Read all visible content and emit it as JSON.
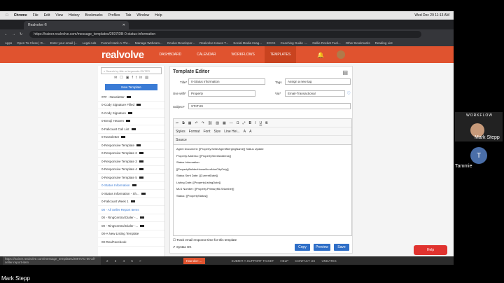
{
  "mac_menu": {
    "apple": "",
    "items": [
      "Chrome",
      "File",
      "Edit",
      "View",
      "History",
      "Bookmarks",
      "Profiles",
      "Tab",
      "Window",
      "Help"
    ],
    "clock": "Wed Dec 29 11:13 AM"
  },
  "browser": {
    "tab_title": "Realvolve ®",
    "url": "https://trainer.realvolve.com/message_templates/2697IDB-0-status-information",
    "bookmarks": [
      "Apps",
      "Open To Close | R...",
      "Enter your email |...",
      "Legal Ads",
      "Funnel Hack-A-Thr...",
      "Manage Webcam...",
      "Oculus Developer...",
      "Realvolve Issues T...",
      "Social Media Imag...",
      "ECCK",
      "Coaching Guide -...",
      "Nellie Rocket Fuel...",
      "Other Bookmarks",
      "Reading List"
    ]
  },
  "app": {
    "logo": "realvolve",
    "nav": [
      "DASHBOARD",
      "CALENDAR",
      "WORKFLOWS",
      "TEMPLATES"
    ],
    "active_nav": "TEMPLATES"
  },
  "sidebar": {
    "search_placeholder": "Search by title or keywords ENTER",
    "new_button": "New Template",
    "items": [
      "### - Newsletter",
      "0-Cody Signature Filled",
      "0-Cody Signature",
      "0-Emoji Heaven",
      "0-Fallcount Call List",
      "0-Newsletter",
      "0-Responsive Template",
      "0-Responsive Template 2",
      "0-Responsive Template 3",
      "0-Responsive Template 4",
      "0-Responsive Template 5",
      "0-Status Information",
      "0-Status Information - Sh...",
      "0-Fallcount Week 1",
      "00 - All Seller Report Items",
      "00 - RingCentral Dialer -...",
      "00 - RingCentral Dialer -...",
      "00-A New Listing Template",
      "00-RealFacebook"
    ],
    "active": "0-Status Information"
  },
  "editor": {
    "heading": "Template Editor",
    "title_label": "Title*",
    "title_value": "0-Status Information",
    "tags_label": "Tags",
    "tags_value": "Assign a new tag",
    "use_with_label": "Use with*",
    "use_with_value": "Property",
    "via_label": "Via*",
    "via_value": "Email-Transactional",
    "subject_label": "Subject*",
    "subject_value": "STATUS",
    "toolbar_row2": [
      "Styles",
      "Format",
      "Font",
      "Size",
      "Line Hei..."
    ],
    "source_label": "Source",
    "body_lines": [
      "Agent Document: [[Property.SellerAgentMergingName]] Status Update",
      "Property Address: [[PropertyStreetAddress]]",
      "Status Information:",
      "[[PropertyBuilderHouseNumNonCityOnly]]",
      "Status Sent Date: [[CurrentDate]]",
      "Listing Date: [[PropertyListingDate]]",
      "MLS Number: [[Property.PrimaryMLSNumber]]",
      "Status: [[PropertyStatus]]"
    ],
    "track_label": "Track email response time for this template",
    "syntax_label": "Syntax OK",
    "copy": "Copy",
    "preview": "Preview",
    "save": "Save"
  },
  "footer": {
    "status_url": "https://trainer.realvolve.com/message_templates/2897IAC-00-all-seller-report-item",
    "pager": [
      "2",
      "3",
      "4",
      "5",
      ">"
    ],
    "howdo": "How do I ...",
    "links": [
      "SUBMIT A SUPPORT TICKET",
      "HELP",
      "CONTACT US",
      "UNDATES"
    ],
    "help": "Help"
  },
  "meeting": {
    "banner": "WORKFLOW",
    "speaker": "Mark Stepp",
    "participant_initial": "T",
    "participant_name": "Tammie",
    "sharer": "Mark Stepp"
  }
}
